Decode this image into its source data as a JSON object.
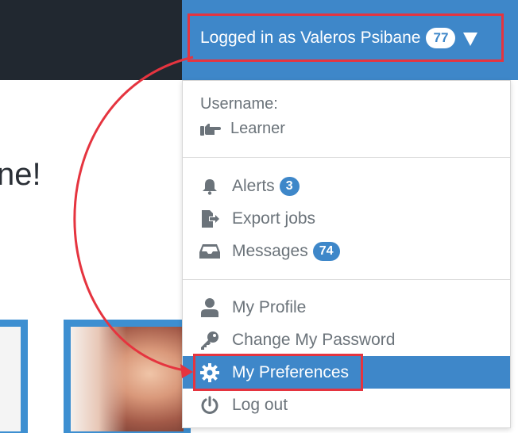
{
  "header": {
    "user_label": "Logged in as Valeros Psibane",
    "notification_count": "77"
  },
  "page": {
    "welcome_fragment": "ne!"
  },
  "dropdown": {
    "username_label": "Username:",
    "role": "Learner",
    "items": [
      {
        "label": "Alerts",
        "count": "3",
        "icon": "bell-icon"
      },
      {
        "label": "Export jobs",
        "icon": "file-export-icon"
      },
      {
        "label": "Messages",
        "count": "74",
        "icon": "inbox-icon"
      },
      {
        "label": "My Profile",
        "icon": "user-icon"
      },
      {
        "label": "Change My Password",
        "icon": "key-icon"
      },
      {
        "label": "My Preferences",
        "icon": "gear-icon",
        "active": true
      },
      {
        "label": "Log out",
        "icon": "power-icon"
      }
    ]
  },
  "colors": {
    "topbar": "#212830",
    "accent": "#3e87c9",
    "annotation": "#e5343f",
    "menu_text": "#6b737a"
  }
}
